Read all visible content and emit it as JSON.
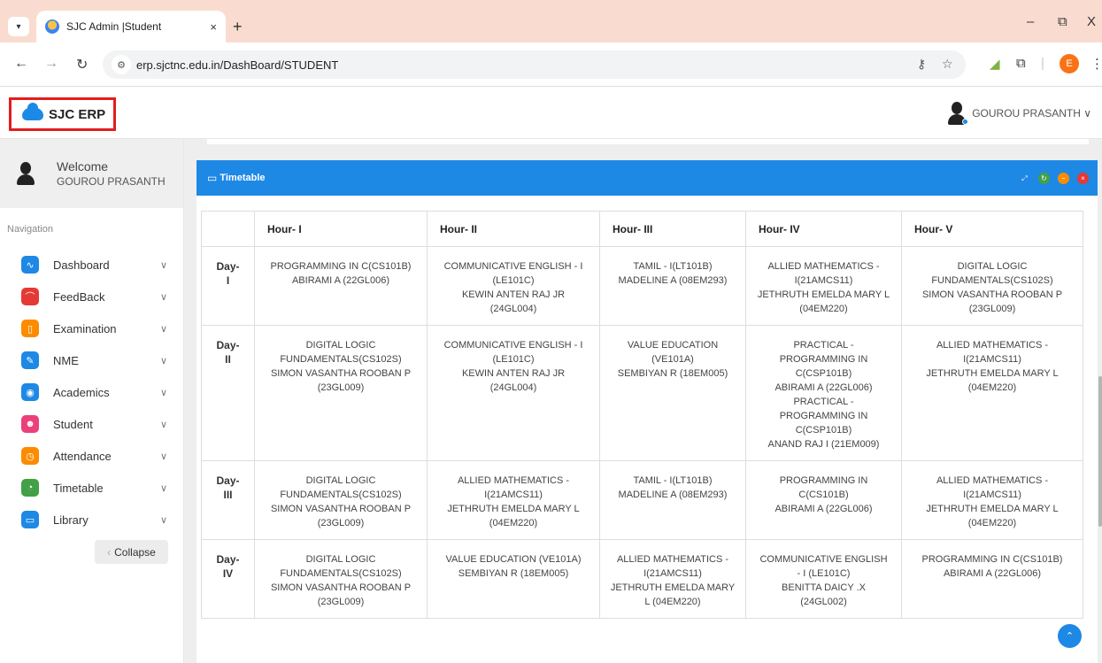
{
  "browser": {
    "tab_title": "SJC Admin |Student",
    "url": "erp.sjctnc.edu.in/DashBoard/STUDENT",
    "profile_initial": "E",
    "newtab_label": "+",
    "close_tab": "×",
    "minimize": "–",
    "restore": "⧉",
    "close_window": "X"
  },
  "app": {
    "brand": "SJC ERP",
    "user_menu_name": "GOUROU PRASANTH ∨"
  },
  "sidebar": {
    "welcome": "Welcome",
    "user_name": "GOUROU PRASANTH",
    "nav_title": "Navigation",
    "items": [
      {
        "label": "Dashboard",
        "icon": "pulse-icon",
        "color": "#1e88e5"
      },
      {
        "label": "FeedBack",
        "icon": "rss-icon",
        "color": "#e53935"
      },
      {
        "label": "Examination",
        "icon": "book-icon",
        "color": "#fb8c00"
      },
      {
        "label": "NME",
        "icon": "edit-icon",
        "color": "#1e88e5"
      },
      {
        "label": "Academics",
        "icon": "target-icon",
        "color": "#1e88e5"
      },
      {
        "label": "Student",
        "icon": "users-icon",
        "color": "#ec407a"
      },
      {
        "label": "Attendance",
        "icon": "clock-icon",
        "color": "#fb8c00"
      },
      {
        "label": "Timetable",
        "icon": "timer-icon",
        "color": "#43a047"
      },
      {
        "label": "Library",
        "icon": "book-open-icon",
        "color": "#1e88e5"
      }
    ],
    "collapse_label": "Collapse"
  },
  "panel": {
    "title": "Timetable",
    "controls": [
      {
        "icon": "expand-icon",
        "color": "#1e88e5"
      },
      {
        "icon": "refresh-icon",
        "color": "#43a047"
      },
      {
        "icon": "minimize-icon",
        "color": "#fb8c00"
      },
      {
        "icon": "close-icon",
        "color": "#e53935"
      }
    ]
  },
  "timetable": {
    "headers": [
      "",
      "Hour- I",
      "Hour- II",
      "Hour- III",
      "Hour- IV",
      "Hour- V"
    ],
    "rows": [
      {
        "day": "Day-\nI",
        "cells": [
          "PROGRAMMING IN C(CS101B)\nABIRAMI A (22GL006)",
          "COMMUNICATIVE ENGLISH - I\n(LE101C)\nKEWIN ANTEN RAJ JR\n(24GL004)",
          "TAMIL - I(LT101B)\nMADELINE A (08EM293)",
          "ALLIED MATHEMATICS -\nI(21AMCS11)\nJETHRUTH EMELDA MARY L\n(04EM220)",
          "DIGITAL LOGIC\nFUNDAMENTALS(CS102S)\nSIMON VASANTHA ROOBAN P\n(23GL009)"
        ]
      },
      {
        "day": "Day-\nII",
        "cells": [
          "DIGITAL LOGIC\nFUNDAMENTALS(CS102S)\nSIMON VASANTHA ROOBAN P\n(23GL009)",
          "COMMUNICATIVE ENGLISH - I\n(LE101C)\nKEWIN ANTEN RAJ JR\n(24GL004)",
          "VALUE EDUCATION\n(VE101A)\nSEMBIYAN R (18EM005)",
          "PRACTICAL -\nPROGRAMMING IN\nC(CSP101B)\nABIRAMI A (22GL006)\nPRACTICAL -\nPROGRAMMING IN\nC(CSP101B)\nANAND RAJ I (21EM009)",
          "ALLIED MATHEMATICS -\nI(21AMCS11)\nJETHRUTH EMELDA MARY L\n(04EM220)"
        ]
      },
      {
        "day": "Day-\nIII",
        "cells": [
          "DIGITAL LOGIC\nFUNDAMENTALS(CS102S)\nSIMON VASANTHA ROOBAN P\n(23GL009)",
          "ALLIED MATHEMATICS -\nI(21AMCS11)\nJETHRUTH EMELDA MARY L\n(04EM220)",
          "TAMIL - I(LT101B)\nMADELINE A (08EM293)",
          "PROGRAMMING IN\nC(CS101B)\nABIRAMI A (22GL006)",
          "ALLIED MATHEMATICS -\nI(21AMCS11)\nJETHRUTH EMELDA MARY L\n(04EM220)"
        ]
      },
      {
        "day": "Day-\nIV",
        "cells": [
          "DIGITAL LOGIC\nFUNDAMENTALS(CS102S)\nSIMON VASANTHA ROOBAN P\n(23GL009)",
          "VALUE EDUCATION (VE101A)\nSEMBIYAN R (18EM005)",
          "ALLIED MATHEMATICS -\nI(21AMCS11)\nJETHRUTH EMELDA MARY\nL (04EM220)",
          "COMMUNICATIVE ENGLISH\n- I (LE101C)\nBENITTA DAICY .X\n(24GL002)",
          "PROGRAMMING IN C(CS101B)\nABIRAMI A (22GL006)"
        ]
      }
    ]
  }
}
